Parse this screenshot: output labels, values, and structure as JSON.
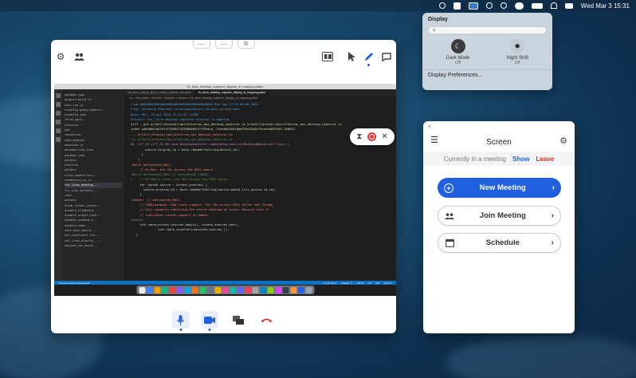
{
  "menubar": {
    "clock": "Wed Mar 3  15:31"
  },
  "display_panel": {
    "title": "Display",
    "brightness_icon": "sun-icon",
    "dark_mode": {
      "label": "Dark Mode",
      "state": "Off",
      "icon": "moon-icon"
    },
    "night_shift": {
      "label": "Night Shift",
      "state": "Off",
      "icon": "sun-icon"
    },
    "preferences_link": "Display Preferences..."
  },
  "share_window": {
    "top_buttons": [
      "—",
      "—",
      "⧉"
    ],
    "shared_screen": {
      "window_title": "fix_linux_desktop_capturer_display_id_mapping.patch",
      "tabs": [
        "set_linux_display_ids_to_match_capturer_ids.patch",
        "fix_linux_desktop_capturer_display_id_mapping.patch"
      ],
      "breadcrumb": "src > third-party > electron > patches > electron > fix_linux_desktop_capturer_display_id_mapping.patch",
      "sidebar_files": [
        "package.json",
        "prepare-build.js",
        "test-ran.js",
        "tsconfig-paths-bootstr...",
        "tsconfig.json",
        "third-party",
        "electron",
        "npm",
        "cachefrost",
        "node_modules",
        "download.js",
        "package-lock.json",
        "package.json",
        "patches",
        "electron",
        "patches",
        "allow_square_corn...",
        "elementary_os_sc...",
        "fix_linux_desktop_...",
        "fix_sync_devtools_...",
        "root",
        "patches",
        "allow_linear_warnin...",
        "disable_clipboard_...",
        "disable_origin_lock...",
        "disable_windows_k...",
        "disable_zoom_...",
        "send_down_captur...",
        "set_constraint_fra...",
        "set_linux_display_...",
        "unblock_ipc_socke..."
      ],
      "selected_file_index": 18,
      "code_lines": [
        "From 0000000000000000000000000000000000000000 Mon Sep 17 00:00:00 2001",
        "From: Jeheonuk Sherwani <jsherwani@users.noreply.github.com>",
        "Date: Mon, 13 Apr 2020 21:45:35 -0700",
        "Subject: fix linux desktop capturer display id mapping",
        "",
        "",
        "diff --git a/shell/browser/api/electron_api_desktop_capturer.cc b/shell/browser/api/electron_api_desktop_capturer.cc",
        "index a4be0ba7a07bfcff48927435960a02cfff55acb..1feea0552dfba633fa31a6cf5ceeba60f495 100644",
        "--- a/shell/browser/api/electron_api_desktop_capturer.cc",
        "+++ b/shell/browser/api/electron_api_desktop_capturer.cc",
        "@@ -177,15 +177,12 @@ void DesktopCapturer::UpdateSourcesList(DesktopMediaList* list) {",
        "        source.display_id = base::NumberToString(device_id);",
        "      }",
        "    }",
        "-#elif defined(OS_MAC)",
        "-    // On Mac, the IDs across the APIs match.",
        "+#elif defined(OS_MAC) || defined(OS_LINUX)",
        "+    // On Mac & Linux, the IDs across the APIs match.",
        "     for (auto& source : screen_sources) {",
        "       source.display_id = base::NumberToString(source.media_list_source.id.id);",
        "     }",
        "-#endif  // defined(OS_MAC)",
        "-    // TODO(ajmacd): Add Linux support. The IDs across APIs differ but Chrome",
        "-    // only supports capturing the entire desktop on Linux. Revisit this if",
        "-    // individual screen support is added.",
        "+#endif",
        "     std::move(screen_sources.begin(), screen_sources.end(),",
        "               std::back_inserter(captured_sources_));",
        "   }"
      ],
      "status_items": [
        "Ln 23, Col 1",
        "Spaces: 2",
        "UTF-8",
        "LF",
        "Diff",
        "CSLint"
      ],
      "status_left": "Pmvoice-screen-ids-are-bad*"
    },
    "floating_controls": {
      "hourglass_icon": "hourglass-icon",
      "record_icon": "record-icon",
      "close_icon": "close-icon"
    },
    "call_controls": [
      "mic-icon",
      "camera-icon",
      "screens-icon",
      "hangup-icon"
    ]
  },
  "app": {
    "title": "Screen",
    "meeting_status": "Currently in a meeting",
    "show_label": "Show",
    "leave_label": "Leave",
    "buttons": [
      {
        "label": "New Meeting",
        "icon": "plus-circle-icon"
      },
      {
        "label": "Join Meeting",
        "icon": "people-icon"
      },
      {
        "label": "Schedule",
        "icon": "calendar-icon"
      }
    ]
  },
  "colors": {
    "accent": "#1f5fe0",
    "danger": "#d93025",
    "editor_bg": "#1e1e1e",
    "status_bar": "#0e70c0"
  }
}
